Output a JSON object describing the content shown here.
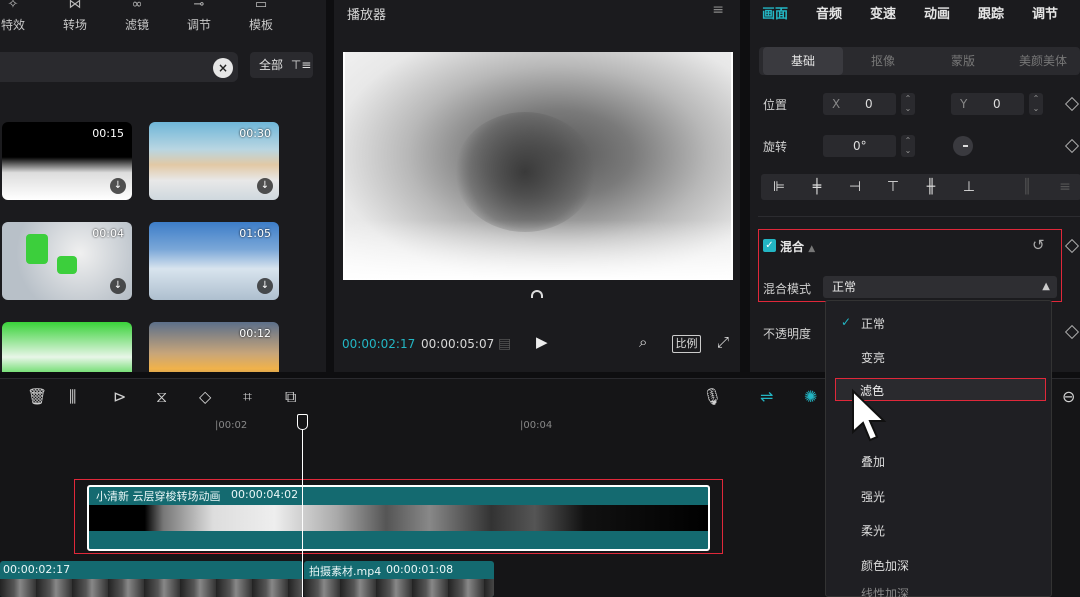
{
  "media_tabs": [
    {
      "label": "特效",
      "icon": "sparkle-icon"
    },
    {
      "label": "转场",
      "icon": "transition-icon"
    },
    {
      "label": "滤镜",
      "icon": "filter-icon"
    },
    {
      "label": "调节",
      "icon": "adjust-icon"
    },
    {
      "label": "模板",
      "icon": "template-icon"
    }
  ],
  "media": {
    "filter_label": "全部",
    "items": [
      {
        "duration": "00:15"
      },
      {
        "duration": "00:30"
      },
      {
        "duration": "00:04"
      },
      {
        "duration": "01:05"
      },
      {
        "duration": ""
      },
      {
        "duration": "00:12"
      }
    ]
  },
  "player": {
    "title": "播放器",
    "current_time": "00:00:02:17",
    "total_time": "00:00:05:07",
    "ratio_label": "比例"
  },
  "props": {
    "tabs": [
      "画面",
      "音频",
      "变速",
      "动画",
      "跟踪",
      "调节"
    ],
    "active_tab": "画面",
    "subtabs": [
      "基础",
      "抠像",
      "蒙版",
      "美颜美体"
    ],
    "position_label": "位置",
    "x_axis": "X",
    "x_value": "0",
    "y_axis": "Y",
    "y_value": "0",
    "rotation_label": "旋转",
    "rotation_value": "0°",
    "blend_title": "混合",
    "blend_mode_label": "混合模式",
    "blend_mode_value": "正常",
    "opacity_label": "不透明度"
  },
  "blend_dropdown": {
    "options": [
      "正常",
      "变亮",
      "滤色",
      "",
      "叠加",
      "强光",
      "柔光",
      "颜色加深",
      "线性加深"
    ],
    "selected": "正常",
    "hovered": "滤色"
  },
  "timeline": {
    "ticks": [
      "|00:02",
      "|00:04"
    ],
    "overlay_clip": {
      "name": "小清新 云层穿梭转场动画",
      "duration": "00:00:04:02"
    },
    "main_clip_1": {
      "duration": "00:00:02:17"
    },
    "main_clip_2": {
      "name": "拍摄素材.mp4",
      "duration": "00:00:01:08"
    }
  },
  "colors": {
    "accent": "#23b6c4",
    "highlight_border": "#e0283a",
    "clip": "#146a70"
  }
}
